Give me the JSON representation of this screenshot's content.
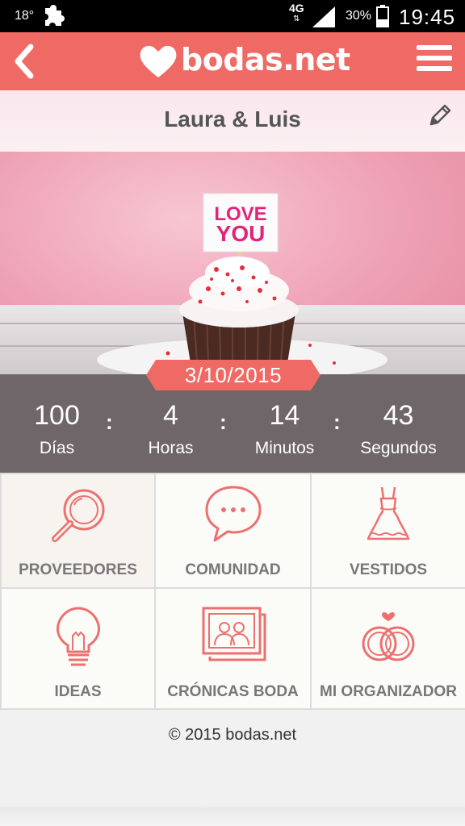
{
  "status_bar": {
    "temperature": "18°",
    "network_type": "4G",
    "network_arrows": "⇅",
    "battery_percent": "30%",
    "time": "19:45"
  },
  "header": {
    "logo_text": "bodas.net"
  },
  "couple": {
    "names": "Laura & Luis"
  },
  "hero": {
    "sign_line1": "LOVE",
    "sign_line2": "YOU"
  },
  "wedding_date": "3/10/2015",
  "countdown": {
    "days": {
      "value": "100",
      "label": "Días"
    },
    "hours": {
      "value": "4",
      "label": "Horas"
    },
    "minutes": {
      "value": "14",
      "label": "Minutos"
    },
    "seconds": {
      "value": "43",
      "label": "Segundos"
    },
    "separator": ":"
  },
  "menu": [
    {
      "label": "PROVEEDORES",
      "icon": "magnifier-icon"
    },
    {
      "label": "COMUNIDAD",
      "icon": "chat-bubble-icon"
    },
    {
      "label": "VESTIDOS",
      "icon": "dress-icon"
    },
    {
      "label": "IDEAS",
      "icon": "lightbulb-icon"
    },
    {
      "label": "CRÓNICAS BODA",
      "icon": "photo-album-icon"
    },
    {
      "label": "MI ORGANIZADOR",
      "icon": "rings-icon"
    }
  ],
  "footer": {
    "copyright": "© 2015 bodas.net"
  },
  "colors": {
    "brand": "#ef6a65",
    "countdown_bg": "#6f6669",
    "icon_stroke": "#ec7070"
  }
}
